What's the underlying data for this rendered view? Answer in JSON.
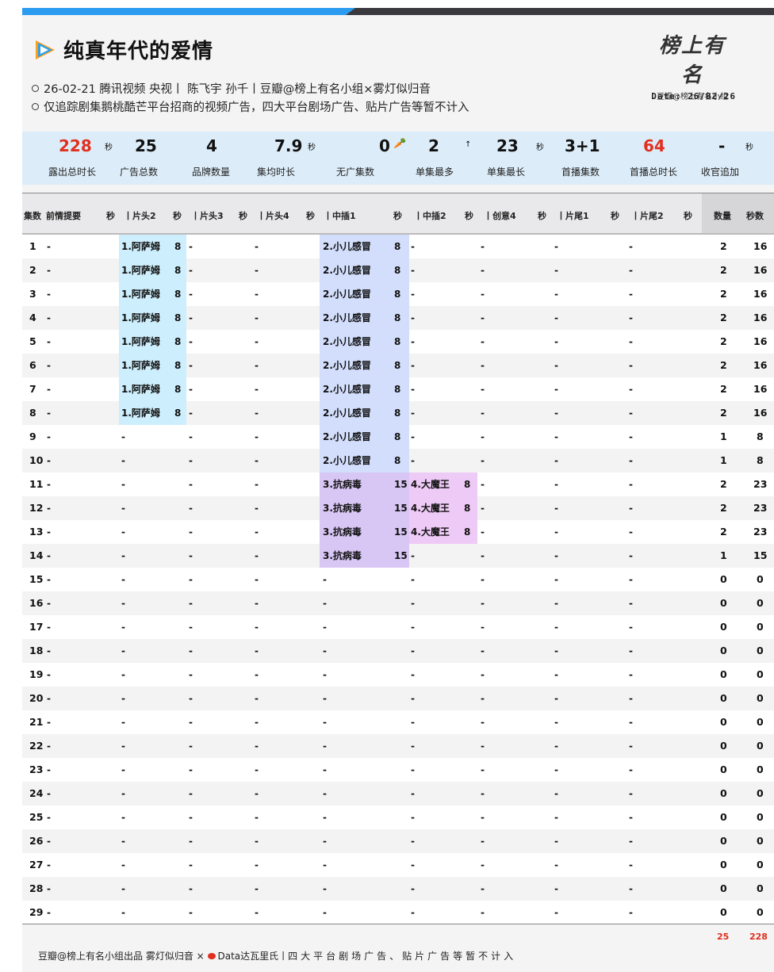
{
  "colors": {
    "accent_blue": "#2b9cf0",
    "highlight_red": "#e0301e",
    "cyan": "#cdeefc",
    "blue": "#d2defc",
    "purple": "#d8c6f4",
    "pink": "#eecaf6"
  },
  "header": {
    "title": "纯真年代的爱情",
    "line1": "26-02-21 腾讯视频 央视丨 陈飞宇 孙千丨豆瓣@榜上有名小组×雾灯似归音",
    "line2": "仅追踪剧集鹅桃酷芒平台招商的视频广告，四大平台剧场广告、贴片广告等暂不计入",
    "logo_script": "榜上有名",
    "logo_sub": "豆瓣@榜上有名小组",
    "date": "Date: 26/02/26"
  },
  "stats": [
    {
      "value": "228",
      "unit": "秒",
      "label": "露出总时长"
    },
    {
      "value": "25",
      "unit": "",
      "label": "广告总数"
    },
    {
      "value": "4",
      "unit": "",
      "label": "品牌数量"
    },
    {
      "value": "7.9",
      "unit": "秒",
      "label": "集均时长"
    },
    {
      "value": "0",
      "unit": "",
      "label": "无广集数"
    },
    {
      "value": "2",
      "unit": "↑",
      "label": "单集最多"
    },
    {
      "value": "23",
      "unit": "秒",
      "label": "单集最长"
    },
    {
      "value": "3+1",
      "unit": "",
      "label": "首播集数"
    },
    {
      "value": "64",
      "unit": "",
      "label": "首播总时长"
    },
    {
      "value": "-",
      "unit": "秒",
      "label": "收官追加"
    }
  ],
  "table": {
    "headers": [
      "集数",
      "前情提要",
      "秒",
      "丨片头2",
      "秒",
      "丨片头3",
      "秒",
      "丨片头4",
      "秒",
      "丨中插1",
      "秒",
      "丨中插2",
      "秒",
      "丨创意4",
      "秒",
      "丨片尾1",
      "秒",
      "丨片尾2",
      "秒",
      "数量",
      "秒数"
    ],
    "rows": [
      {
        "ep": "1",
        "pt2": "1.阿萨姆",
        "pt2s": "8",
        "m1": "2.小儿感冒",
        "m1s": "8",
        "m2": "-",
        "m2s": "",
        "count": "2",
        "secs": "16"
      },
      {
        "ep": "2",
        "pt2": "1.阿萨姆",
        "pt2s": "8",
        "m1": "2.小儿感冒",
        "m1s": "8",
        "m2": "-",
        "m2s": "",
        "count": "2",
        "secs": "16"
      },
      {
        "ep": "3",
        "pt2": "1.阿萨姆",
        "pt2s": "8",
        "m1": "2.小儿感冒",
        "m1s": "8",
        "m2": "-",
        "m2s": "",
        "count": "2",
        "secs": "16"
      },
      {
        "ep": "4",
        "pt2": "1.阿萨姆",
        "pt2s": "8",
        "m1": "2.小儿感冒",
        "m1s": "8",
        "m2": "-",
        "m2s": "",
        "count": "2",
        "secs": "16"
      },
      {
        "ep": "5",
        "pt2": "1.阿萨姆",
        "pt2s": "8",
        "m1": "2.小儿感冒",
        "m1s": "8",
        "m2": "-",
        "m2s": "",
        "count": "2",
        "secs": "16"
      },
      {
        "ep": "6",
        "pt2": "1.阿萨姆",
        "pt2s": "8",
        "m1": "2.小儿感冒",
        "m1s": "8",
        "m2": "-",
        "m2s": "",
        "count": "2",
        "secs": "16"
      },
      {
        "ep": "7",
        "pt2": "1.阿萨姆",
        "pt2s": "8",
        "m1": "2.小儿感冒",
        "m1s": "8",
        "m2": "-",
        "m2s": "",
        "count": "2",
        "secs": "16"
      },
      {
        "ep": "8",
        "pt2": "1.阿萨姆",
        "pt2s": "8",
        "m1": "2.小儿感冒",
        "m1s": "8",
        "m2": "-",
        "m2s": "",
        "count": "2",
        "secs": "16"
      },
      {
        "ep": "9",
        "pt2": "-",
        "pt2s": "",
        "m1": "2.小儿感冒",
        "m1s": "8",
        "m2": "-",
        "m2s": "",
        "count": "1",
        "secs": "8"
      },
      {
        "ep": "10",
        "pt2": "-",
        "pt2s": "",
        "m1": "2.小儿感冒",
        "m1s": "8",
        "m2": "-",
        "m2s": "",
        "count": "1",
        "secs": "8"
      },
      {
        "ep": "11",
        "pt2": "-",
        "pt2s": "",
        "m1": "3.抗病毒",
        "m1s": "15",
        "m2": "4.大魔王",
        "m2s": "8",
        "count": "2",
        "secs": "23"
      },
      {
        "ep": "12",
        "pt2": "-",
        "pt2s": "",
        "m1": "3.抗病毒",
        "m1s": "15",
        "m2": "4.大魔王",
        "m2s": "8",
        "count": "2",
        "secs": "23"
      },
      {
        "ep": "13",
        "pt2": "-",
        "pt2s": "",
        "m1": "3.抗病毒",
        "m1s": "15",
        "m2": "4.大魔王",
        "m2s": "8",
        "count": "2",
        "secs": "23"
      },
      {
        "ep": "14",
        "pt2": "-",
        "pt2s": "",
        "m1": "3.抗病毒",
        "m1s": "15",
        "m2": "-",
        "m2s": "",
        "count": "1",
        "secs": "15"
      },
      {
        "ep": "15",
        "pt2": "-",
        "pt2s": "",
        "m1": "-",
        "m1s": "",
        "m2": "-",
        "m2s": "",
        "count": "0",
        "secs": "0"
      },
      {
        "ep": "16",
        "pt2": "-",
        "pt2s": "",
        "m1": "-",
        "m1s": "",
        "m2": "-",
        "m2s": "",
        "count": "0",
        "secs": "0"
      },
      {
        "ep": "17",
        "pt2": "-",
        "pt2s": "",
        "m1": "-",
        "m1s": "",
        "m2": "-",
        "m2s": "",
        "count": "0",
        "secs": "0"
      },
      {
        "ep": "18",
        "pt2": "-",
        "pt2s": "",
        "m1": "-",
        "m1s": "",
        "m2": "-",
        "m2s": "",
        "count": "0",
        "secs": "0"
      },
      {
        "ep": "19",
        "pt2": "-",
        "pt2s": "",
        "m1": "-",
        "m1s": "",
        "m2": "-",
        "m2s": "",
        "count": "0",
        "secs": "0"
      },
      {
        "ep": "20",
        "pt2": "-",
        "pt2s": "",
        "m1": "-",
        "m1s": "",
        "m2": "-",
        "m2s": "",
        "count": "0",
        "secs": "0"
      },
      {
        "ep": "21",
        "pt2": "-",
        "pt2s": "",
        "m1": "-",
        "m1s": "",
        "m2": "-",
        "m2s": "",
        "count": "0",
        "secs": "0"
      },
      {
        "ep": "22",
        "pt2": "-",
        "pt2s": "",
        "m1": "-",
        "m1s": "",
        "m2": "-",
        "m2s": "",
        "count": "0",
        "secs": "0"
      },
      {
        "ep": "23",
        "pt2": "-",
        "pt2s": "",
        "m1": "-",
        "m1s": "",
        "m2": "-",
        "m2s": "",
        "count": "0",
        "secs": "0"
      },
      {
        "ep": "24",
        "pt2": "-",
        "pt2s": "",
        "m1": "-",
        "m1s": "",
        "m2": "-",
        "m2s": "",
        "count": "0",
        "secs": "0"
      },
      {
        "ep": "25",
        "pt2": "-",
        "pt2s": "",
        "m1": "-",
        "m1s": "",
        "m2": "-",
        "m2s": "",
        "count": "0",
        "secs": "0"
      },
      {
        "ep": "26",
        "pt2": "-",
        "pt2s": "",
        "m1": "-",
        "m1s": "",
        "m2": "-",
        "m2s": "",
        "count": "0",
        "secs": "0"
      },
      {
        "ep": "27",
        "pt2": "-",
        "pt2s": "",
        "m1": "-",
        "m1s": "",
        "m2": "-",
        "m2s": "",
        "count": "0",
        "secs": "0"
      },
      {
        "ep": "28",
        "pt2": "-",
        "pt2s": "",
        "m1": "-",
        "m1s": "",
        "m2": "-",
        "m2s": "",
        "count": "0",
        "secs": "0"
      },
      {
        "ep": "29",
        "pt2": "-",
        "pt2s": "",
        "m1": "-",
        "m1s": "",
        "m2": "-",
        "m2s": "",
        "count": "0",
        "secs": "0"
      }
    ],
    "empty_mark": "-"
  },
  "footer": {
    "total_count": "25",
    "total_secs": "228",
    "credit_a": "豆瓣@榜上有名小组出品  雾灯似归音 × ",
    "credit_b": "Data达瓦里氏丨",
    "credit_c": "四大平台剧场广告、贴片广告等暂不计入"
  }
}
